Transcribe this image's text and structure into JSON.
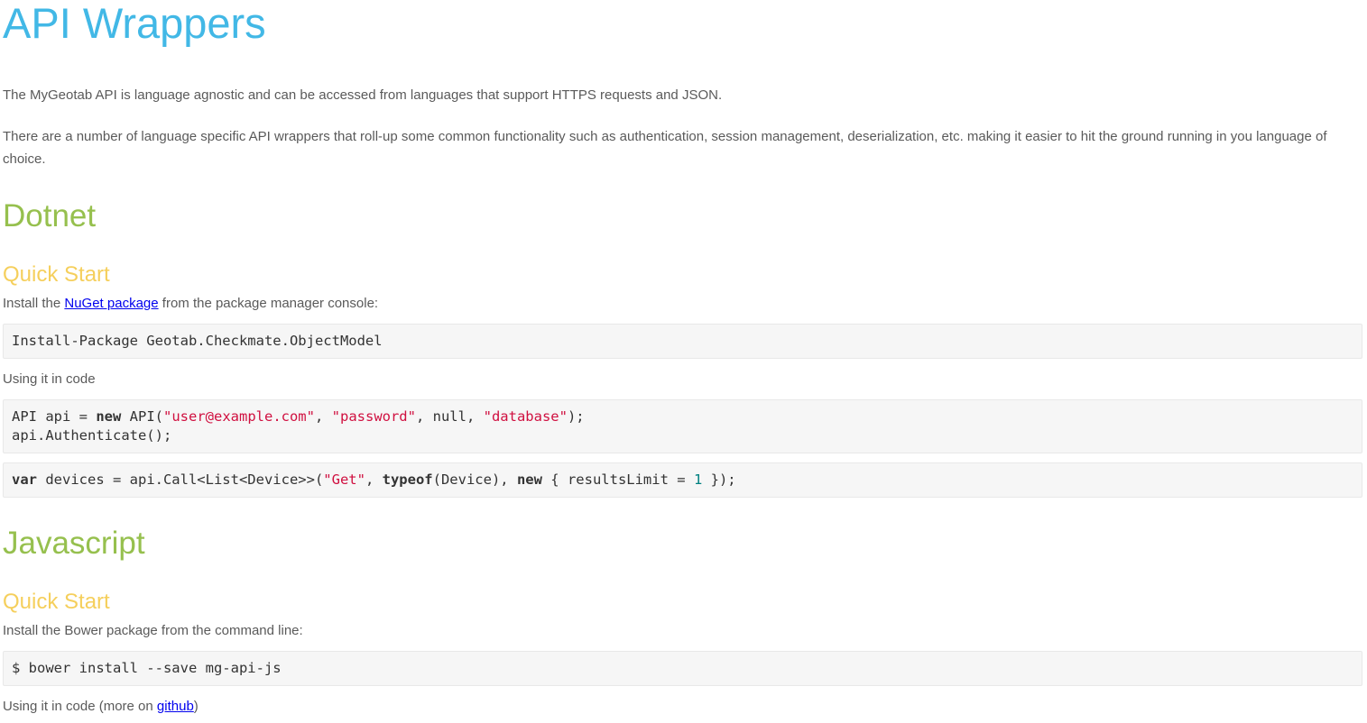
{
  "page": {
    "title": "API Wrappers",
    "intro_1": "The MyGeotab API is language agnostic and can be accessed from languages that support HTTPS requests and JSON.",
    "intro_2": "There are a number of language specific API wrappers that roll-up some common functionality such as authentication, session management, deserialization, etc. making it easier to hit the ground running in you language of choice."
  },
  "colors": {
    "title": "#42b8e6",
    "section_heading": "#96c04e",
    "subsection_heading": "#f5cf5c",
    "link": "#0000ee",
    "string_literal": "#d01040",
    "number_literal": "#008080",
    "code_background": "#f6f6f6"
  },
  "dotnet": {
    "heading": "Dotnet",
    "quick_start": "Quick Start",
    "install_prefix": "Install the ",
    "install_link": "NuGet package",
    "install_suffix": " from the package manager console:",
    "install_cmd": "Install-Package Geotab.Checkmate.ObjectModel",
    "usage_text": "Using it in code",
    "code1": {
      "l1_a": "API api = ",
      "l1_new": "new",
      "l1_b": " API(",
      "l1_s1": "\"user@example.com\"",
      "l1_c": ", ",
      "l1_s2": "\"password\"",
      "l1_d": ", null, ",
      "l1_s3": "\"database\"",
      "l1_e": ");",
      "l2": "api.Authenticate();"
    },
    "code2": {
      "var": "var",
      "a": " devices = api.Call<List<Device>>(",
      "s1": "\"Get\"",
      "b": ", ",
      "typeof": "typeof",
      "c": "(Device), ",
      "new": "new",
      "d": " { resultsLimit = ",
      "num": "1",
      "e": " });"
    }
  },
  "javascript": {
    "heading": "Javascript",
    "quick_start": "Quick Start",
    "install_text": "Install the Bower package from the command line:",
    "install_cmd": "$ bower install --save mg-api-js",
    "usage_prefix": "Using it in code (more on ",
    "usage_link": "github",
    "usage_suffix": ")"
  }
}
